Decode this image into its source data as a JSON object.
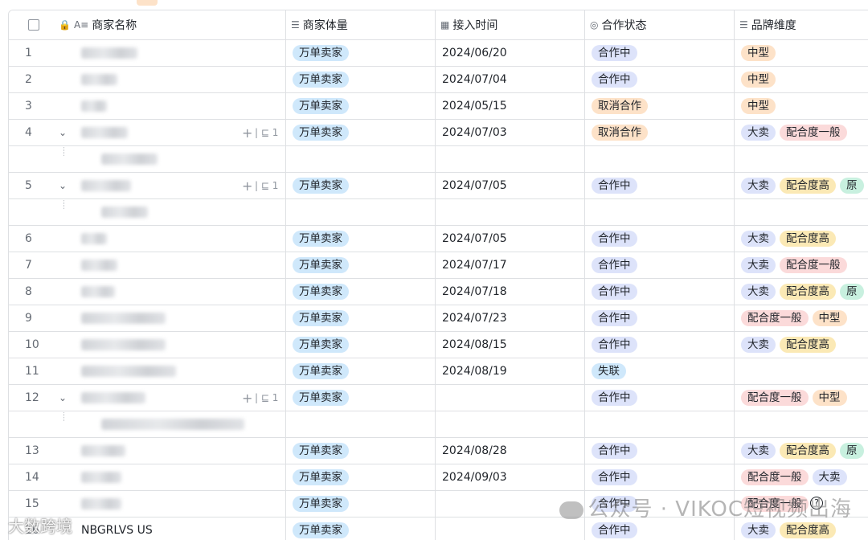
{
  "columns": [
    {
      "icon": "A≡",
      "label": "商家名称"
    },
    {
      "icon": "☰",
      "label": "商家体量"
    },
    {
      "icon": "▦",
      "label": "接入时间"
    },
    {
      "icon": "◎",
      "label": "合作状态"
    },
    {
      "icon": "☰",
      "label": "品牌维度"
    }
  ],
  "rows": [
    {
      "num": "1",
      "volume": "万单卖家",
      "date": "2024/06/20",
      "status": "合作中",
      "status_color": "lav",
      "brand": [
        {
          "t": "中型",
          "c": "orange"
        }
      ],
      "blurW": 70
    },
    {
      "num": "2",
      "volume": "万单卖家",
      "date": "2024/07/04",
      "status": "合作中",
      "status_color": "lav",
      "brand": [
        {
          "t": "中型",
          "c": "orange"
        }
      ],
      "blurW": 45
    },
    {
      "num": "3",
      "volume": "万单卖家",
      "date": "2024/05/15",
      "status": "取消合作",
      "status_color": "orange",
      "brand": [
        {
          "t": "中型",
          "c": "orange"
        }
      ],
      "blurW": 32
    },
    {
      "num": "4",
      "volume": "万单卖家",
      "date": "2024/07/03",
      "status": "取消合作",
      "status_color": "orange",
      "brand": [
        {
          "t": "大卖",
          "c": "lav"
        },
        {
          "t": "配合度一般",
          "c": "pink"
        }
      ],
      "blurW": 58,
      "parent": true,
      "sub": "1",
      "childBlurW": 70
    },
    {
      "num": "5",
      "volume": "万单卖家",
      "date": "2024/07/05",
      "status": "合作中",
      "status_color": "lav",
      "brand": [
        {
          "t": "大卖",
          "c": "lav"
        },
        {
          "t": "配合度高",
          "c": "yellow"
        },
        {
          "t": "原",
          "c": "teal"
        }
      ],
      "blurW": 62,
      "parent": true,
      "sub": "1",
      "childBlurW": 58
    },
    {
      "num": "6",
      "volume": "万单卖家",
      "date": "2024/07/05",
      "status": "合作中",
      "status_color": "lav",
      "brand": [
        {
          "t": "大卖",
          "c": "lav"
        },
        {
          "t": "配合度高",
          "c": "yellow"
        }
      ],
      "blurW": 32
    },
    {
      "num": "7",
      "volume": "万单卖家",
      "date": "2024/07/17",
      "status": "合作中",
      "status_color": "lav",
      "brand": [
        {
          "t": "大卖",
          "c": "lav"
        },
        {
          "t": "配合度一般",
          "c": "pink"
        }
      ],
      "blurW": 45
    },
    {
      "num": "8",
      "volume": "万单卖家",
      "date": "2024/07/18",
      "status": "合作中",
      "status_color": "lav",
      "brand": [
        {
          "t": "大卖",
          "c": "lav"
        },
        {
          "t": "配合度高",
          "c": "yellow"
        },
        {
          "t": "原",
          "c": "teal"
        }
      ],
      "blurW": 42
    },
    {
      "num": "9",
      "volume": "万单卖家",
      "date": "2024/07/23",
      "status": "合作中",
      "status_color": "lav",
      "brand": [
        {
          "t": "配合度一般",
          "c": "pink"
        },
        {
          "t": "中型",
          "c": "orange"
        }
      ],
      "blurW": 105
    },
    {
      "num": "10",
      "volume": "万单卖家",
      "date": "2024/08/15",
      "status": "合作中",
      "status_color": "lav",
      "brand": [
        {
          "t": "大卖",
          "c": "lav"
        },
        {
          "t": "配合度高",
          "c": "yellow"
        }
      ],
      "blurW": 105
    },
    {
      "num": "11",
      "volume": "万单卖家",
      "date": "2024/08/19",
      "status": "失联",
      "status_color": "blue",
      "brand": [],
      "blurW": 118
    },
    {
      "num": "12",
      "volume": "万单卖家",
      "date": "",
      "status": "合作中",
      "status_color": "lav",
      "brand": [
        {
          "t": "配合度一般",
          "c": "pink"
        },
        {
          "t": "中型",
          "c": "orange"
        }
      ],
      "blurW": 80,
      "parent": true,
      "sub": "1",
      "childBlurW": 178
    },
    {
      "num": "13",
      "volume": "万单卖家",
      "date": "2024/08/28",
      "status": "合作中",
      "status_color": "lav",
      "brand": [
        {
          "t": "大卖",
          "c": "lav"
        },
        {
          "t": "配合度高",
          "c": "yellow"
        },
        {
          "t": "原",
          "c": "teal"
        }
      ],
      "blurW": 55
    },
    {
      "num": "14",
      "volume": "万单卖家",
      "date": "2024/09/03",
      "status": "合作中",
      "status_color": "lav",
      "brand": [
        {
          "t": "配合度一般",
          "c": "pink"
        },
        {
          "t": "大卖",
          "c": "lav"
        }
      ],
      "blurW": 50
    },
    {
      "num": "15",
      "volume": "万单卖家",
      "date": "",
      "status": "合作中",
      "status_color": "lav",
      "brand": [
        {
          "t": "配合度一般",
          "c": "pink"
        }
      ],
      "blurW": 50
    },
    {
      "num": "16",
      "volume": "万单卖家",
      "date": "",
      "status": "合作中",
      "status_color": "lav",
      "brand": [
        {
          "t": "大卖",
          "c": "lav"
        },
        {
          "t": "配合度高",
          "c": "yellow"
        }
      ],
      "plain": "NBGRLVS US"
    }
  ],
  "watermark": {
    "text": "公众号 · VIKOC短视频出海"
  },
  "watermark2": {
    "text": "大数跨境"
  },
  "help": {
    "label": "?"
  }
}
